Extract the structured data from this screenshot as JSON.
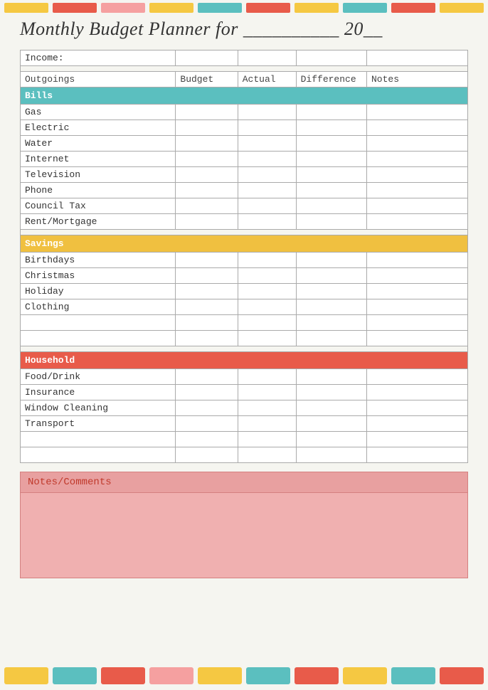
{
  "title": {
    "text": "Monthly Budget Planner for __________ 20__"
  },
  "topBar": {
    "colors": [
      "#f5c842",
      "#e85b4a",
      "#f5a0a0",
      "#f5c842",
      "#5bbfbf",
      "#e85b4a",
      "#f5c842",
      "#5bbfbf",
      "#e85b4a",
      "#f5c842"
    ]
  },
  "bottomBar": {
    "colors": [
      "#f5c842",
      "#5bbfbf",
      "#e85b4a",
      "#f5a0a0",
      "#f5c842",
      "#5bbfbf",
      "#e85b4a",
      "#f5c842",
      "#5bbfbf",
      "#e85b4a"
    ]
  },
  "table": {
    "incomeLabel": "Income:",
    "headers": {
      "outgoings": "Outgoings",
      "budget": "Budget",
      "actual": "Actual",
      "difference": "Difference",
      "notes": "Notes"
    },
    "sections": {
      "bills": {
        "label": "Bills",
        "items": [
          "Gas",
          "Electric",
          "Water",
          "Internet",
          "Television",
          "Phone",
          "Council Tax",
          "Rent/Mortgage"
        ]
      },
      "savings": {
        "label": "Savings",
        "items": [
          "Birthdays",
          "Christmas",
          "Holiday",
          "Clothing"
        ]
      },
      "household": {
        "label": "Household",
        "items": [
          "Food/Drink",
          "Insurance",
          "Window Cleaning",
          "Transport"
        ]
      }
    }
  },
  "notesSection": {
    "label": "Notes/Comments"
  }
}
